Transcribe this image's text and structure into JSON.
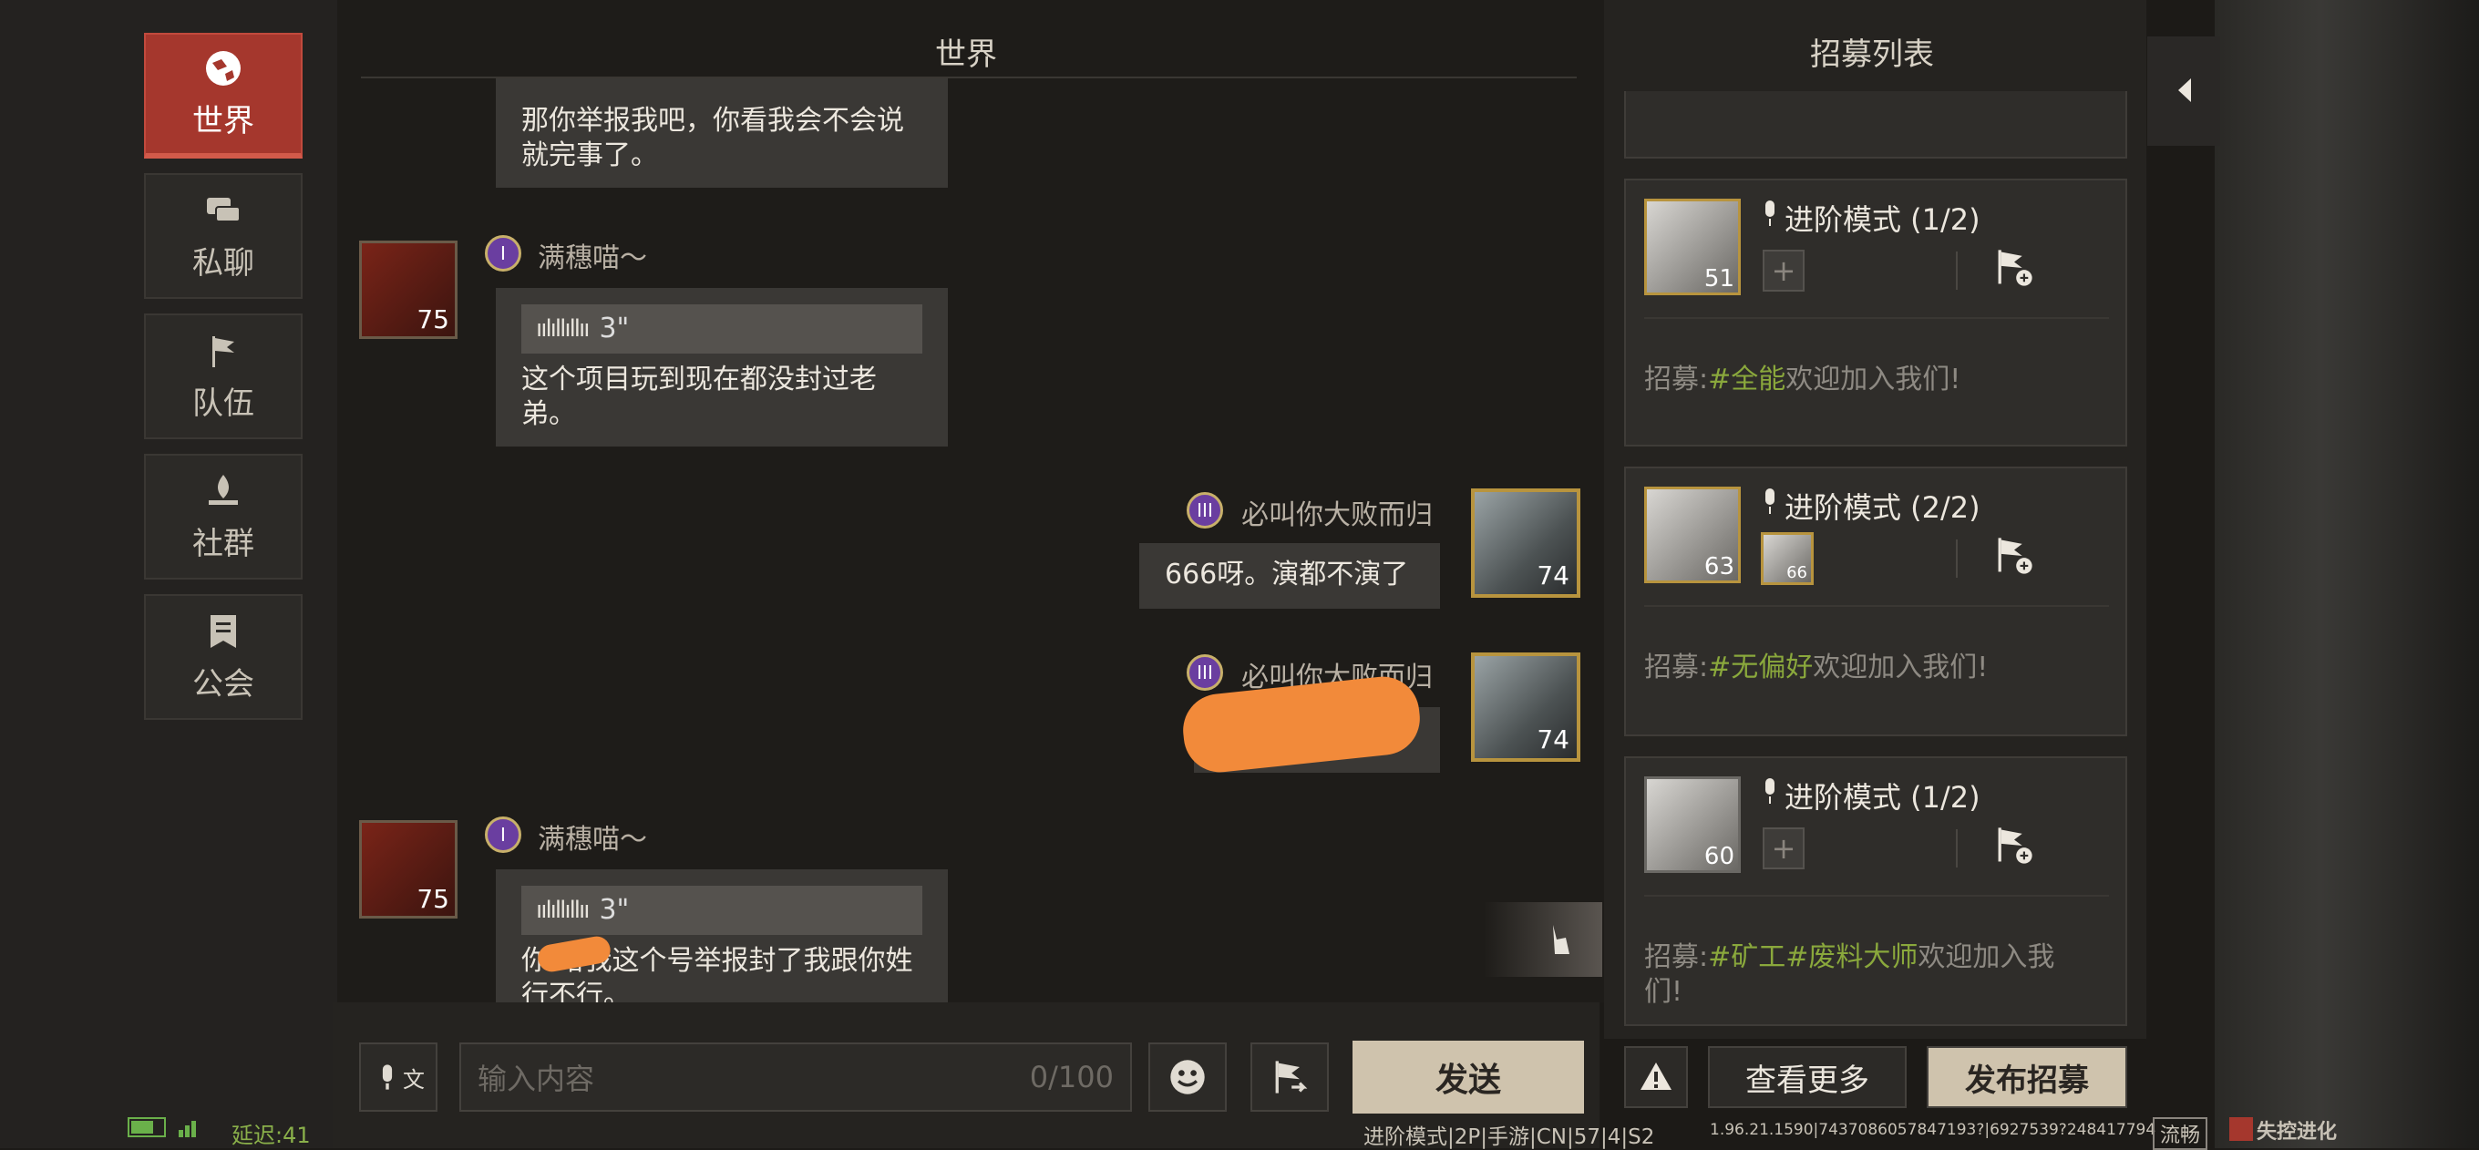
{
  "nav": {
    "world": "世界",
    "private": "私聊",
    "team": "队伍",
    "community": "社群",
    "guild": "公会"
  },
  "chat": {
    "title": "世界",
    "messages": [
      {
        "text": "那你举报我吧，你看我会不会说就完事了。"
      },
      {
        "user": "满穗喵～",
        "level": "75",
        "badge": "I",
        "voice_duration": "3\"",
        "text": "这个项目玩到现在都没封过老弟。"
      },
      {
        "user": "必叫你大败而归",
        "level": "74",
        "badge": "III",
        "text": "666呀。演都不演了"
      },
      {
        "user": "必叫你大败而归",
        "level": "74",
        "badge": "III",
        "text": ""
      },
      {
        "user": "满穗喵～",
        "level": "75",
        "badge": "I",
        "voice_duration": "3\"",
        "text": "你        给我这个号举报封了我跟你姓行不行。"
      }
    ]
  },
  "input": {
    "placeholder": "输入内容",
    "counter": "0/100",
    "send": "发送",
    "translate_icon": "文"
  },
  "recruit": {
    "title": "招募列表",
    "cards": [
      {
        "mode": "进阶模式 (1/2)",
        "level": "51",
        "prefix": "招募:",
        "tags": "#全能",
        "suffix": "欢迎加入我们!"
      },
      {
        "mode": "进阶模式 (2/2)",
        "level": "63",
        "level2": "66",
        "prefix": "招募:",
        "tags": "#无偏好",
        "suffix": "欢迎加入我们!"
      },
      {
        "mode": "进阶模式 (1/2)",
        "level": "60",
        "prefix": "招募:",
        "tags": "#矿工#废料大师",
        "suffix": "欢迎加入我们!"
      }
    ],
    "more": "查看更多",
    "publish": "发布招募"
  },
  "status": {
    "latency": "延迟:41",
    "mode_info": "进阶模式|2P|手游|CN|57|4|S2",
    "version": "1.96.21.1590|7437086057847193?|6927539?248417794",
    "network": "流畅",
    "logo": "失控进化"
  },
  "colors": {
    "accent_red": "#a5372d",
    "tag_green": "#8aa83c",
    "gold": "#b8943e"
  }
}
